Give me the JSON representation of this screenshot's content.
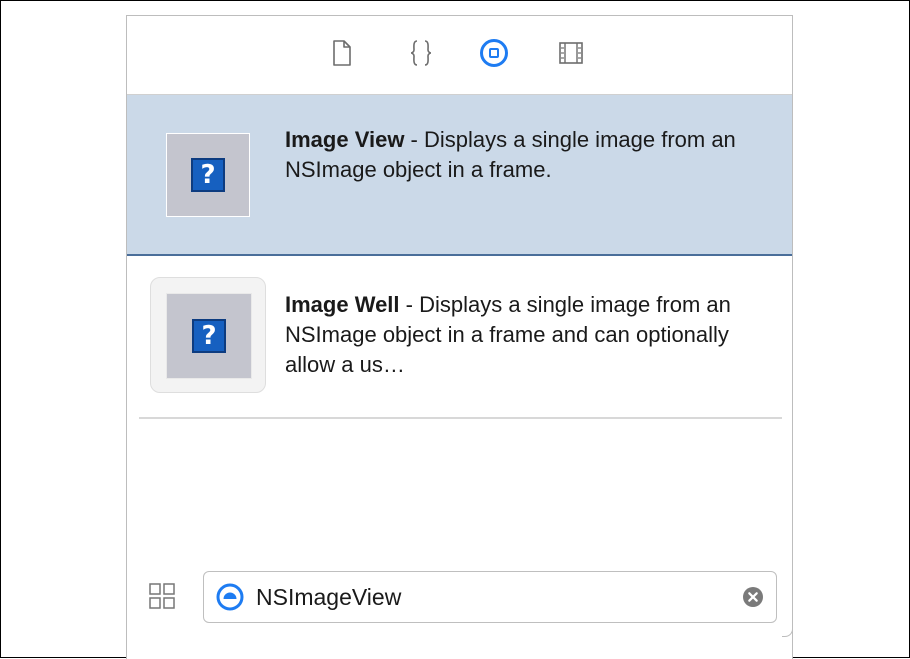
{
  "tabs": [
    {
      "name": "file-template-tab",
      "icon": "document-icon",
      "selected": false
    },
    {
      "name": "code-snippet-tab",
      "icon": "braces-icon",
      "selected": false
    },
    {
      "name": "object-library-tab",
      "icon": "object-library-icon",
      "selected": true
    },
    {
      "name": "media-library-tab",
      "icon": "film-icon",
      "selected": false
    }
  ],
  "items": [
    {
      "title": "Image View",
      "description": " - Displays a single image from an NSImage object in a frame.",
      "icon": "image-view-icon",
      "selected": true
    },
    {
      "title": "Image Well",
      "description": " - Displays a single image from an NSImage object in a frame and can optionally allow a us…",
      "icon": "image-well-icon",
      "selected": false
    }
  ],
  "thumbnail_glyph": "?",
  "search": {
    "value": "NSImageView",
    "kind_icon": "object-type-icon",
    "clear_icon": "clear-icon"
  },
  "footer": {
    "view_toggle_icon": "grid-view-icon"
  },
  "colors": {
    "accent": "#1e7cf2",
    "selection_bg": "#cbd9e8",
    "selection_border": "#4a6e9a",
    "thumb_bg": "#c4c5ce",
    "question_mark": "#1660c0"
  }
}
